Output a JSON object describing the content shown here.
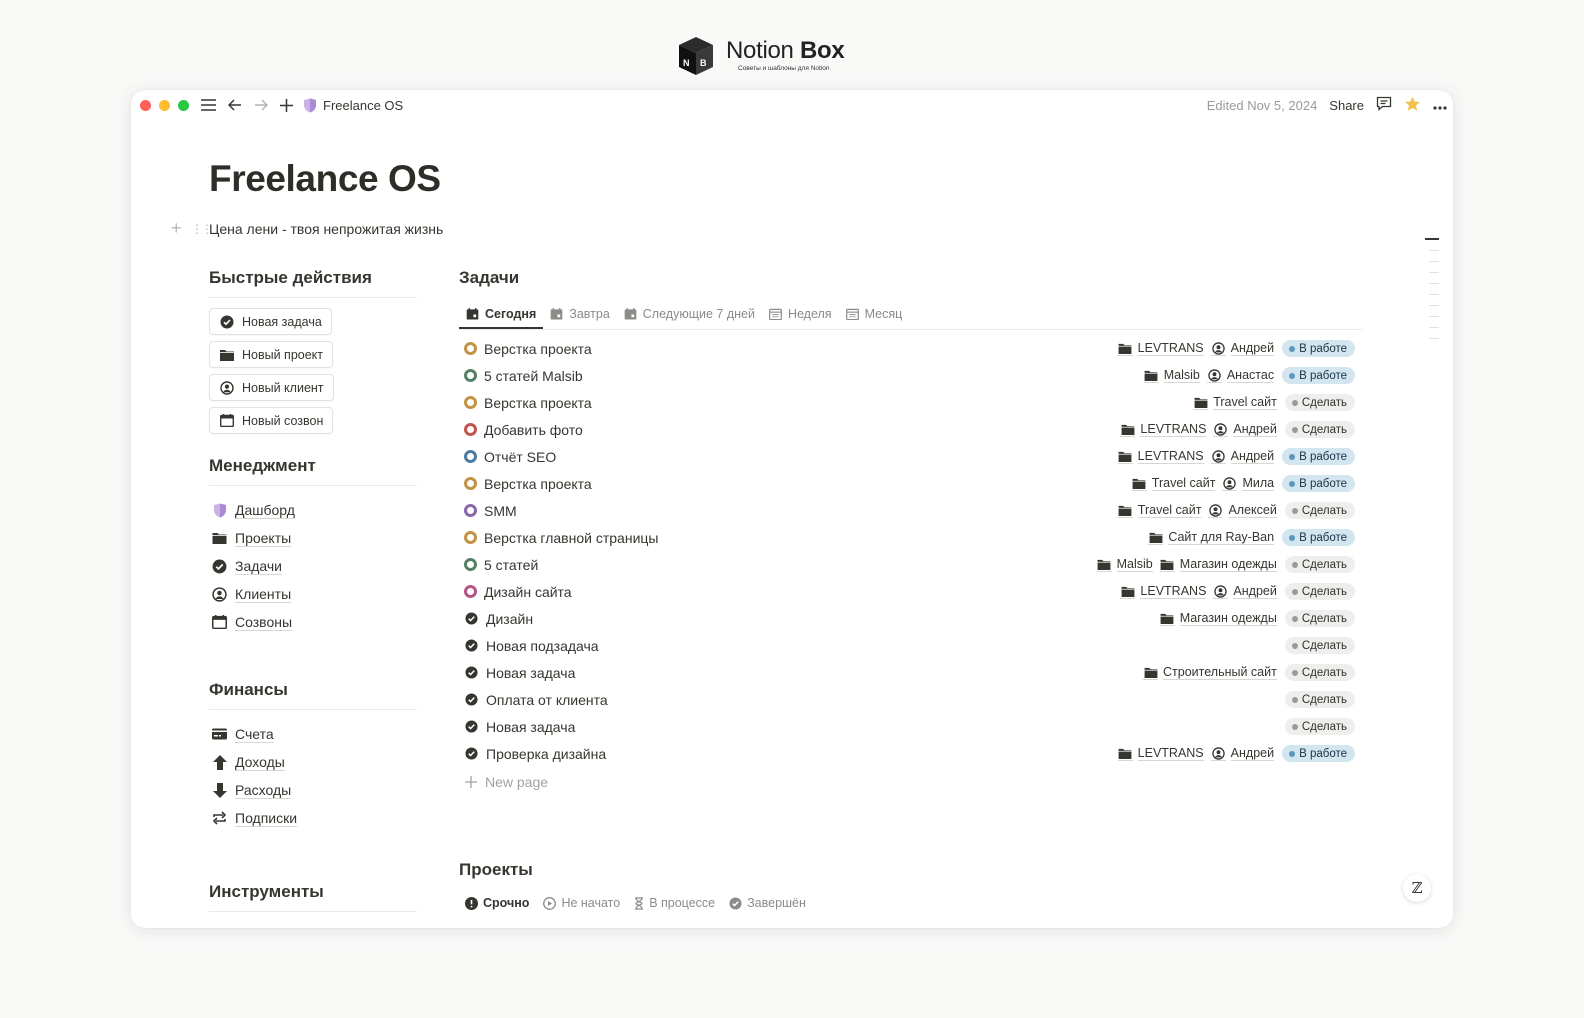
{
  "brand": {
    "name_regular": "Notion ",
    "name_bold": "Box",
    "tagline": "Советы и шаблоны для Notion"
  },
  "topbar": {
    "page": "Freelance OS",
    "edited": "Edited Nov 5, 2024",
    "share": "Share"
  },
  "page": {
    "title": "Freelance OS",
    "subtitle": "Цена лени - твоя непрожитая жизнь"
  },
  "quick_actions": {
    "heading": "Быстрые действия",
    "buttons": [
      {
        "label": "Новая задача",
        "icon": "check-circle-icon"
      },
      {
        "label": "Новый проект",
        "icon": "folder-icon"
      },
      {
        "label": "Новый клиент",
        "icon": "user-circle-icon"
      },
      {
        "label": "Новый созвон",
        "icon": "calendar-icon"
      }
    ]
  },
  "management": {
    "heading": "Менеджмент",
    "items": [
      {
        "label": "Дашборд",
        "icon": "shield-icon"
      },
      {
        "label": "Проекты",
        "icon": "folder-icon"
      },
      {
        "label": "Задачи",
        "icon": "check-circle-icon"
      },
      {
        "label": "Клиенты",
        "icon": "user-circle-icon"
      },
      {
        "label": "Созвоны",
        "icon": "calendar-icon"
      }
    ]
  },
  "finance": {
    "heading": "Финансы",
    "items": [
      {
        "label": "Счета",
        "icon": "card-icon"
      },
      {
        "label": "Доходы",
        "icon": "arrow-up-icon"
      },
      {
        "label": "Расходы",
        "icon": "arrow-down-icon"
      },
      {
        "label": "Подписки",
        "icon": "repeat-icon"
      }
    ]
  },
  "tools": {
    "heading": "Инструменты"
  },
  "tasks": {
    "heading": "Задачи",
    "tabs": [
      "Сегодня",
      "Завтра",
      "Следующие 7 дней",
      "Неделя",
      "Месяц"
    ],
    "new_page": "New page",
    "rows": [
      {
        "title": "Верстка проекта",
        "project": "LEVTRANS",
        "client": "Андрей",
        "status": "В работе"
      },
      {
        "title": "5 статей Malsib",
        "project": "Malsib",
        "client": "Анастас",
        "status": "В работе"
      },
      {
        "title": "Верстка проекта",
        "project": "Travel сайт",
        "status": "Сделать"
      },
      {
        "title": "Добавить фото",
        "project": "LEVTRANS",
        "client": "Андрей",
        "status": "Сделать"
      },
      {
        "title": "Отчёт SEO",
        "project": "LEVTRANS",
        "client": "Андрей",
        "status": "В работе"
      },
      {
        "title": "Верстка проекта",
        "project": "Travel сайт",
        "client": "Мила",
        "status": "В работе"
      },
      {
        "title": "SMM",
        "project": "Travel сайт",
        "client": "Алексей",
        "status": "Сделать"
      },
      {
        "title": "Верстка главной страницы",
        "project": "Сайт для Ray-Ban",
        "status": "В работе"
      },
      {
        "title": "5 статей",
        "project": "Malsib",
        "project2": "Магазин одежды",
        "status": "Сделать"
      },
      {
        "title": "Дизайн сайта",
        "project": "LEVTRANS",
        "client": "Андрей",
        "status": "Сделать"
      },
      {
        "title": "Дизайн",
        "project": "Магазин одежды",
        "status": "Сделать"
      },
      {
        "title": "Новая подзадача",
        "status": "Сделать"
      },
      {
        "title": "Новая задача",
        "project": "Строительный сайт",
        "status": "Сделать"
      },
      {
        "title": "Оплата от клиента",
        "status": "Сделать"
      },
      {
        "title": "Новая задача",
        "status": "Сделать"
      },
      {
        "title": "Проверка дизайна",
        "project": "LEVTRANS",
        "client": "Андрей",
        "status": "В работе"
      }
    ]
  },
  "projects": {
    "heading": "Проекты",
    "tabs": [
      "Срочно",
      "Не начато",
      "В процессе",
      "Завершён"
    ]
  },
  "colors": {
    "dot_orange": "#c29343",
    "dot_green": "#548164",
    "dot_red": "#c4554d",
    "dot_blue": "#487ca5",
    "dot_purple": "#8a67ab",
    "dot_pink": "#b35488",
    "badge_work_bg": "#d3e5ef",
    "badge_todo_bg": "#eeeeec"
  }
}
